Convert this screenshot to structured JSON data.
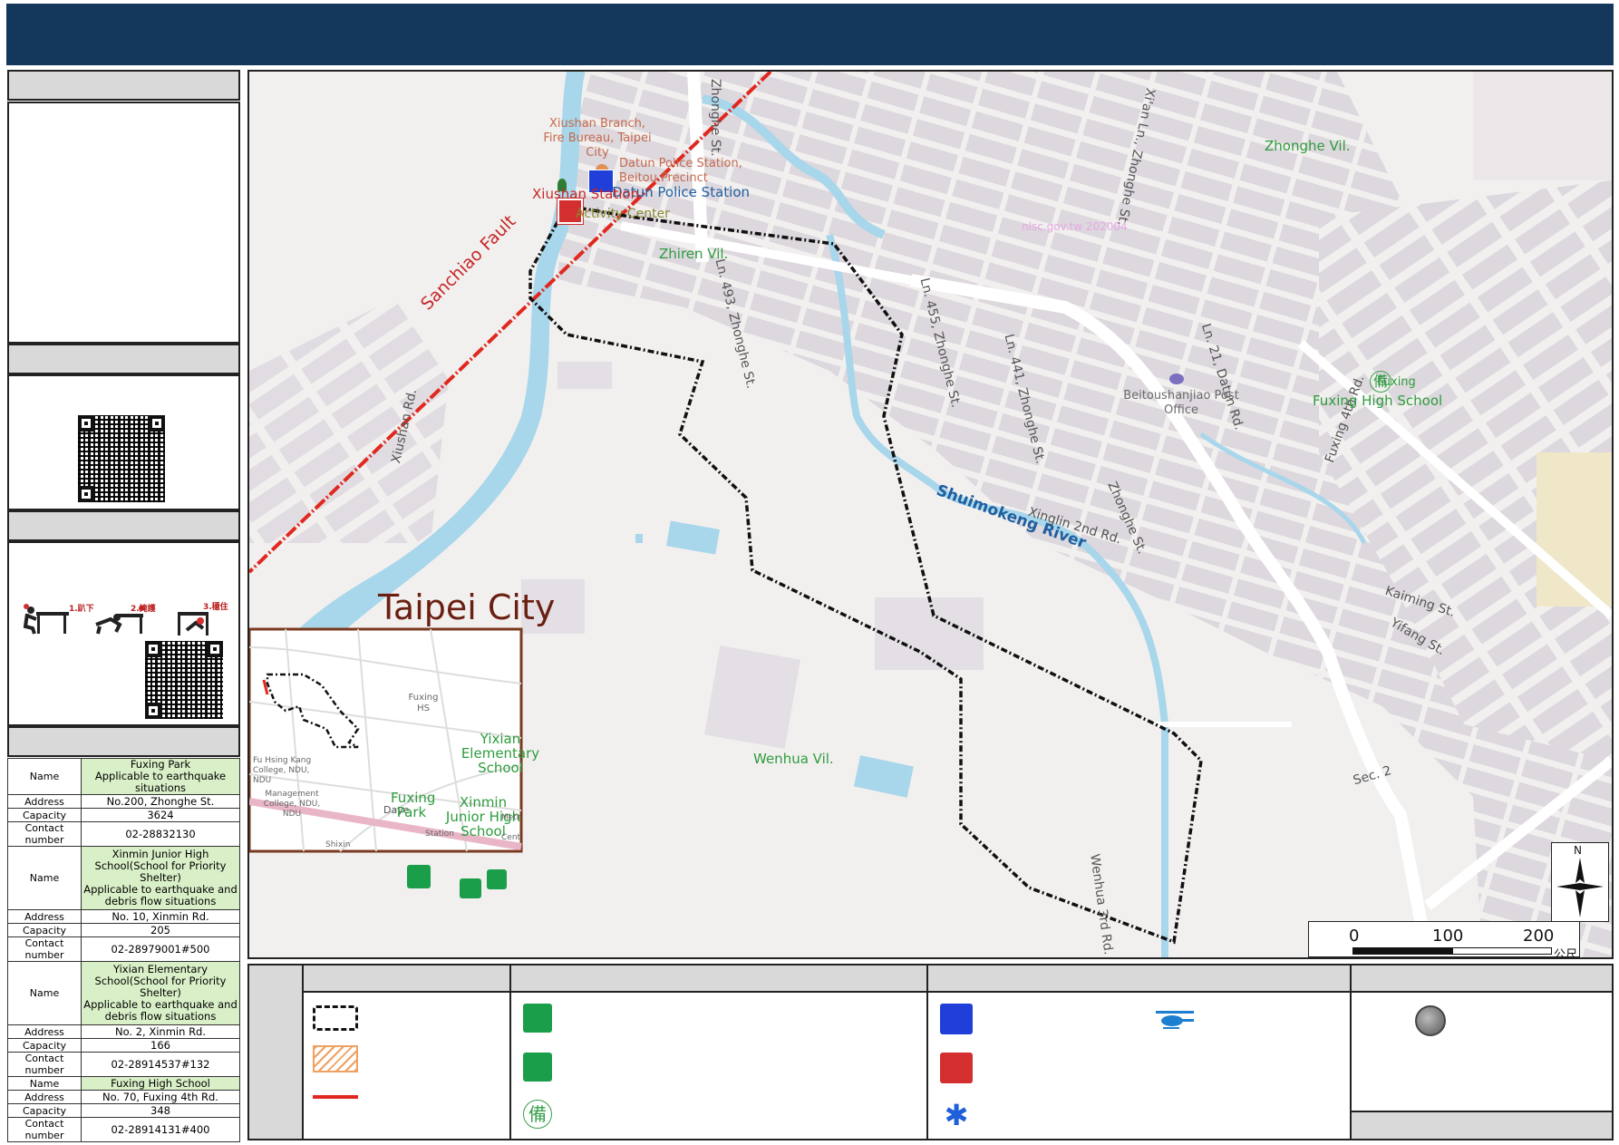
{
  "map": {
    "city_label": "Taipei City",
    "fault_label": "Sanchiao Fault",
    "river_label": "Shuimokeng River",
    "watermark": "nlsc.gov.tw 202004",
    "villages": [
      "Zhonghe Vil.",
      "Zhiren Vil.",
      "Wenhua Vil."
    ],
    "streets": {
      "xiushan_rd": "Xiushan Rd.",
      "zhonghe_st_top": "Zhonghe St.",
      "zhonghe_st_right": "Zhonghe St.",
      "ln493": "Ln. 493, Zhonghe St.",
      "ln455": "Ln. 455, Zhonghe St.",
      "ln441": "Ln. 441, Zhonghe St.",
      "ln21": "Ln. 21, Datun Rd.",
      "xian_ln": "Xi'an Ln., Zhonghe St.",
      "xinglin": "Xinglin 2nd Rd.",
      "wenhua": "Wenhua 3rd Rd.",
      "kaiming": "Kaiming St.",
      "yifang": "Yifang St.",
      "fuxing_4th": "Fuxing 4th Rd.",
      "sec2": "Sec. 2"
    },
    "pois": {
      "fire_bureau": "Xiushan Branch, Fire Bureau, Taipei City",
      "police_precinct": "Datun Police Station, Beitou Precinct",
      "police_station": "Datun Police Station",
      "xiushan_station": "Xiushan Station",
      "activity_center": "Activity Center",
      "post_office": "Beitoushanjiao Post Office",
      "fuxing_hs_small": "Fuxing",
      "fuxing_hs": "Fuxing High School"
    },
    "scale": {
      "ticks": [
        "0",
        "100",
        "200"
      ],
      "unit": "公尺"
    },
    "north_label": "N",
    "inset": {
      "fuxing_hs": "Fuxing HS",
      "fu_hsing_kang": "Fu Hsing Kang College, NDU, NDU",
      "management": "Management College, NDU, NDU",
      "daye": "Daye",
      "yixian": "Yixian Elementary School",
      "fuxing_park": "Fuxing Park",
      "xinmin": "Xinmin Junior High School",
      "station": "Station",
      "shixin": "Shixin",
      "metro": "Metr",
      "cent": "Cent"
    }
  },
  "drill": {
    "labels": [
      "1.趴下",
      "2.掩護",
      "3.穩住"
    ]
  },
  "shelters": [
    {
      "name": "Fuxing Park\nApplicable to earthquake situations",
      "address": "No.200, Zhonghe St.",
      "capacity": "3624",
      "contact": "02-28832130"
    },
    {
      "name": "Xinmin Junior High School(School for Priority Shelter)\nApplicable to earthquake and debris flow situations",
      "address": "No. 10, Xinmin Rd.",
      "capacity": "205",
      "contact": "02-28979001#500"
    },
    {
      "name": "Yixian Elementary School(School for Priority Shelter)\nApplicable to earthquake and debris flow situations",
      "address": "No. 2, Xinmin Rd.",
      "capacity": "166",
      "contact": "02-28914537#132"
    },
    {
      "name": "Fuxing High School",
      "address": "No. 70, Fuxing 4th Rd.",
      "capacity": "348",
      "contact": "02-28914131#400"
    }
  ],
  "table_keys": {
    "name": "Name",
    "address": "Address",
    "capacity": "Capacity",
    "contact": "Contact number"
  },
  "legend": {
    "backup_glyph": "備"
  },
  "colors": {
    "header": "#14375c",
    "fault": "#e0281f",
    "river": "#a8d6ea",
    "shelter_green": "#1a9e4a",
    "police_blue": "#1f3fd8",
    "fire_red": "#d32f2f"
  }
}
